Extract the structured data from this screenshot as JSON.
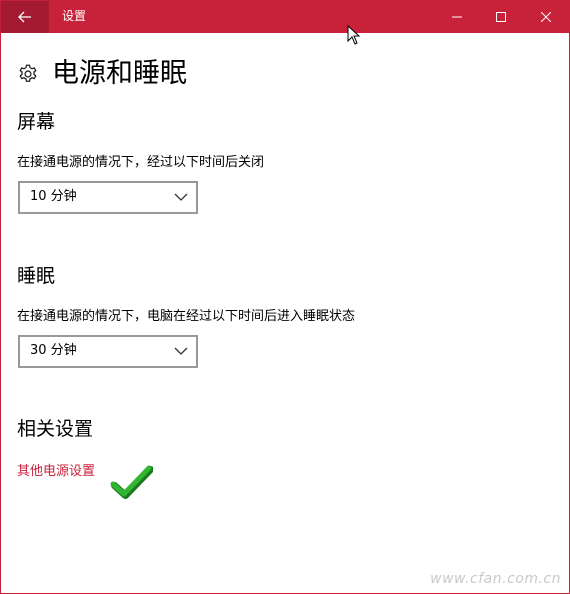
{
  "window": {
    "title": "设置",
    "accent_color": "#c8213a"
  },
  "header": {
    "icon": "gear-icon",
    "title": "电源和睡眠"
  },
  "screen": {
    "heading": "屏幕",
    "description": "在接通电源的情况下，经过以下时间后关闭",
    "selected": "10 分钟"
  },
  "sleep": {
    "heading": "睡眠",
    "description": "在接通电源的情况下，电脑在经过以下时间后进入睡眠状态",
    "selected": "30 分钟"
  },
  "related": {
    "heading": "相关设置",
    "link": "其他电源设置"
  },
  "watermark": "www.cfan.com.cn"
}
